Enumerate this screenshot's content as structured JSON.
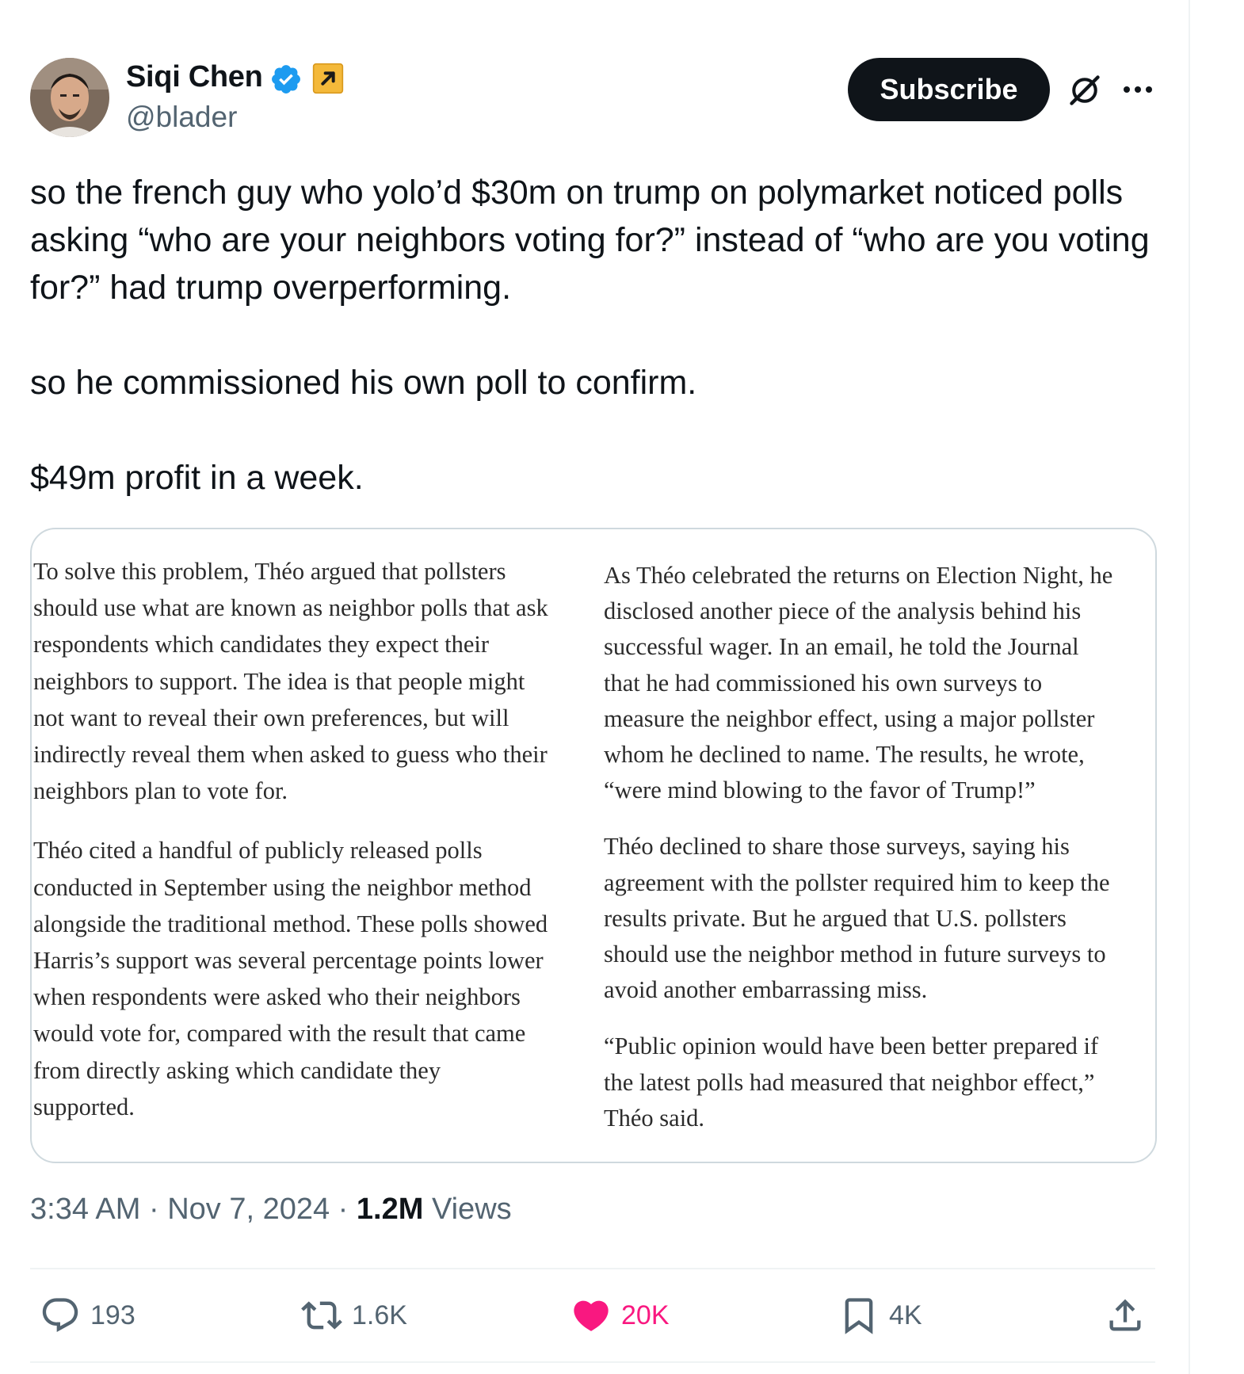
{
  "author": {
    "name": "Siqi Chen",
    "handle": "@blader",
    "avatar_icon": "avatar-photo",
    "verified_icon": "verified-badge-icon",
    "affiliate_icon": "arrow-affiliate-badge-icon"
  },
  "header": {
    "subscribe_label": "Subscribe",
    "grok_icon": "grok-icon",
    "more_icon": "more-icon"
  },
  "tweet": {
    "paragraphs": [
      "so the french guy who yolo’d $30m on trump on polymarket noticed polls asking “who are your neighbors voting for?” instead of “who are you voting for?” had trump overperforming.",
      "so he commissioned his own poll to confirm.",
      "$49m profit in a week."
    ]
  },
  "media": {
    "left_column": [
      [
        "To solve this problem, Théo argued that pollsters",
        "should use what are known as neighbor polls that ask",
        "respondents which candidates they expect their",
        "neighbors to support. The idea is that people might",
        "not want to reveal their own preferences, but will",
        "indirectly reveal them when asked to guess who their",
        "neighbors plan to vote for."
      ],
      [
        "Théo cited a handful of publicly released polls",
        "conducted in September using the neighbor method",
        "alongside the traditional method. These polls showed",
        "Harris’s support was several percentage points lower",
        "when respondents were asked who their neighbors",
        "would vote for, compared with the result that came",
        "from directly asking which candidate they",
        "supported."
      ]
    ],
    "right_column": [
      [
        "As Théo celebrated the returns on Election Night, he",
        "disclosed another piece of the analysis behind his",
        "successful wager. In an email, he told the Journal",
        "that he had commissioned his own surveys to",
        "measure the neighbor effect, using a major pollster",
        "whom he declined to name. The results, he wrote,",
        "“were mind blowing to the favor of Trump!”"
      ],
      [
        "Théo declined to share those surveys, saying his",
        "agreement with the pollster required him to keep the",
        "results private. But he argued that U.S. pollsters",
        "should use the neighbor method in future surveys to",
        "avoid another embarrassing miss."
      ],
      [
        "“Public opinion would have been better prepared if",
        "the latest polls had measured that neighbor effect,”",
        "Théo said."
      ]
    ]
  },
  "meta": {
    "time": "3:34 AM",
    "separator": " · ",
    "date": "Nov 7, 2024",
    "views_count": "1.2M",
    "views_label": "Views"
  },
  "actions": {
    "replies": "193",
    "reposts": "1.6K",
    "likes": "20K",
    "bookmarks": "4K"
  },
  "colors": {
    "text": "#0f1419",
    "secondary": "#536471",
    "like": "#f91880",
    "verified": "#1d9bf0",
    "affiliate_badge": "#f4b93a",
    "border": "#cfd9de"
  }
}
